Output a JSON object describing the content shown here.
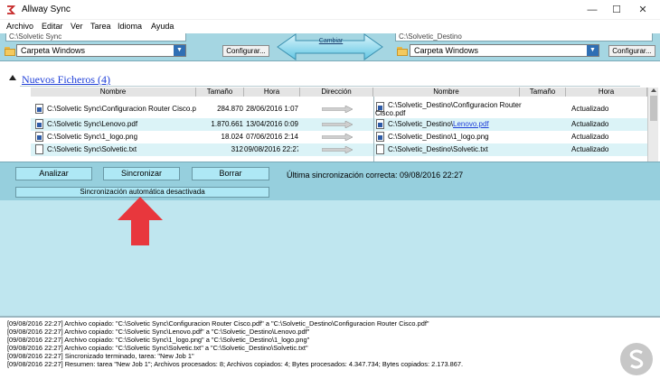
{
  "window": {
    "title": "Allway Sync"
  },
  "menu": [
    "Archivo",
    "Editar",
    "Ver",
    "Tarea",
    "Idioma",
    "Ayuda"
  ],
  "top": {
    "left_path": "C:\\Solvetic Sync",
    "right_path": "C:\\Solvetic_Destino",
    "left_type": "Carpeta Windows",
    "right_type": "Carpeta Windows",
    "configure_label": "Configurar...",
    "swap_label": "Cambiar"
  },
  "section": {
    "title": "Nuevos Ficheros (4)"
  },
  "headers": {
    "left_name": "Nombre",
    "size": "Tamaño",
    "time": "Hora",
    "direction": "Dirección",
    "right_name": "Nombre",
    "right_size": "Tamaño",
    "right_time": "Hora"
  },
  "rows": [
    {
      "src": "C:\\Solvetic Sync\\Configuracion Router Cisco.pdf",
      "size": "284.870",
      "date": "28/06/2016 1:07",
      "dest_prefix": "C:\\Solvetic_Destino\\Configuracion Router",
      "dest_file": "Cisco.pdf",
      "status": "Actualizado"
    },
    {
      "src": "C:\\Solvetic Sync\\Lenovo.pdf",
      "size": "1.870.661",
      "date": "13/04/2016 0:09",
      "dest_prefix": "C:\\Solvetic_Destino\\",
      "dest_file": "Lenovo.pdf",
      "status": "Actualizado"
    },
    {
      "src": "C:\\Solvetic Sync\\1_logo.png",
      "size": "18.024",
      "date": "07/06/2016 2:14",
      "dest_prefix": "C:\\Solvetic_Destino\\",
      "dest_file": "1_logo.png",
      "status": "Actualizado"
    },
    {
      "src": "C:\\Solvetic Sync\\Solvetic.txt",
      "size": "312",
      "date": "09/08/2016 22:27",
      "dest_prefix": "C:\\Solvetic_Destino\\",
      "dest_file": "Solvetic.txt",
      "status": "Actualizado"
    }
  ],
  "actions": {
    "analyze": "Analizar",
    "sync": "Sincronizar",
    "delete": "Borrar",
    "last_sync": "Última sincronización correcta: 09/08/2016 22:27",
    "auto_sync": "Sincronización automática desactivada"
  },
  "log": [
    "[09/08/2016 22:27] Archivo copiado: \"C:\\Solvetic Sync\\Configuracion Router Cisco.pdf\" a \"C:\\Solvetic_Destino\\Configuracion Router Cisco.pdf\"",
    "[09/08/2016 22:27] Archivo copiado: \"C:\\Solvetic Sync\\Lenovo.pdf\" a \"C:\\Solvetic_Destino\\Lenovo.pdf\"",
    "[09/08/2016 22:27] Archivo copiado: \"C:\\Solvetic Sync\\1_logo.png\" a \"C:\\Solvetic_Destino\\1_logo.png\"",
    "[09/08/2016 22:27] Archivo copiado: \"C:\\Solvetic Sync\\Solvetic.txt\" a \"C:\\Solvetic_Destino\\Solvetic.txt\"",
    "[09/08/2016 22:27] Sincronizado terminado, tarea: \"New Job 1\"",
    "[09/08/2016 22:27] Resumen: tarea \"New Job 1\"; Archivos procesados: 8; Archivos copiados: 4; Bytes procesados: 4.347.734; Bytes copiados: 2.173.867."
  ],
  "colors": {
    "panel": "#96cfdd",
    "panel_light": "#bfe6ef",
    "link": "#1f3fd8",
    "highlight_arrow": "#e8373d"
  }
}
